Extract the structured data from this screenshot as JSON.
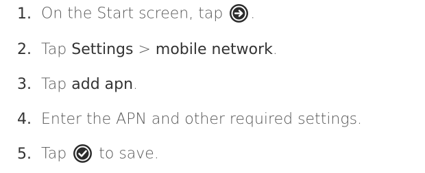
{
  "steps": [
    {
      "number": "1.",
      "text_before": "On the Start screen, tap ",
      "icon": "arrow-right-circle-icon",
      "text_after": "."
    },
    {
      "number": "2.",
      "text_before": "Tap ",
      "bold_1": "Settings",
      "separator": " > ",
      "bold_2": "mobile network",
      "text_after": "."
    },
    {
      "number": "3.",
      "text_before": "Tap ",
      "bold_1": "add apn",
      "text_after": "."
    },
    {
      "number": "4.",
      "text_before": "Enter the APN and other required settings."
    },
    {
      "number": "5.",
      "text_before": "Tap ",
      "icon": "checkmark-circle-icon",
      "text_after": " to save."
    }
  ],
  "colors": {
    "text": "#555555",
    "emphasis": "#333333",
    "icon_fill": "#2b2b2b"
  }
}
